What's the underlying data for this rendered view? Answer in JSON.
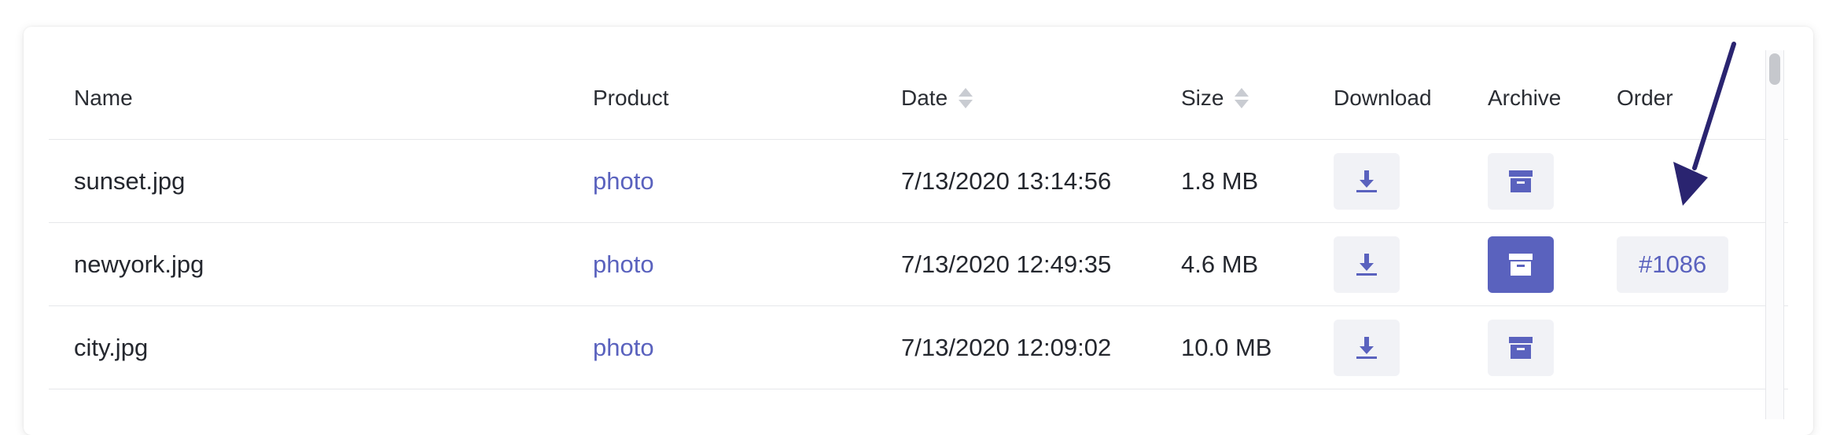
{
  "table": {
    "headers": {
      "name": "Name",
      "product": "Product",
      "date": "Date",
      "size": "Size",
      "download": "Download",
      "archive": "Archive",
      "order": "Order"
    },
    "rows": [
      {
        "name": "sunset.jpg",
        "product": "photo",
        "date": "7/13/2020 13:14:56",
        "size": "1.8 MB",
        "archived": false,
        "order": ""
      },
      {
        "name": "newyork.jpg",
        "product": "photo",
        "date": "7/13/2020 12:49:35",
        "size": "4.6 MB",
        "archived": true,
        "order": "#1086"
      },
      {
        "name": "city.jpg",
        "product": "photo",
        "date": "7/13/2020 12:09:02",
        "size": "10.0 MB",
        "archived": false,
        "order": ""
      }
    ]
  },
  "icons": {
    "download": "download-icon",
    "archive": "archive-box-icon",
    "sort": "sort-icon",
    "annotation": "arrow-pointer-icon"
  },
  "colors": {
    "accent": "#5a62be",
    "button_bg": "#f1f2f6",
    "arrow": "#2a2470"
  }
}
